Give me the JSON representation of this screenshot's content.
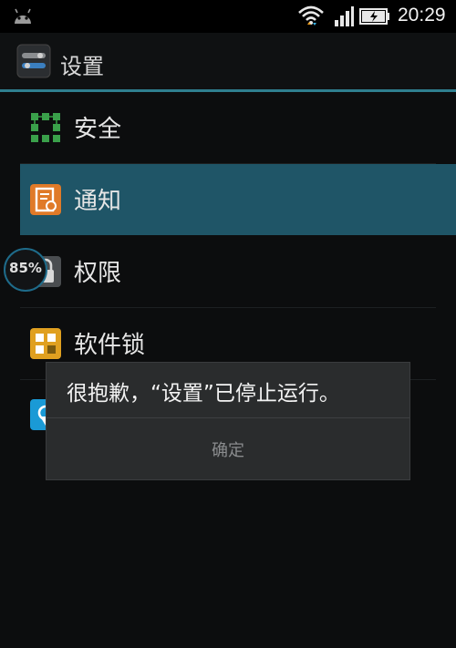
{
  "status_bar": {
    "time": "20:29",
    "icons": [
      "android-icon",
      "wifi-icon",
      "signal-icon",
      "battery-charging-icon"
    ]
  },
  "action_bar": {
    "title": "设置",
    "icon": "settings-app-icon"
  },
  "list": {
    "items": [
      {
        "label": "安全",
        "icon": "security-grid-icon",
        "selected": false
      },
      {
        "label": "通知",
        "icon": "notification-icon",
        "selected": true
      },
      {
        "label": "权限",
        "icon": "permission-lock-icon",
        "selected": false
      },
      {
        "label": "软件锁",
        "icon": "app-lock-icon",
        "selected": false
      }
    ]
  },
  "floating_widget": {
    "text": "85%",
    "icon": "memory-boost-icon"
  },
  "dialog": {
    "message": "很抱歉，“设置”已停止运行。",
    "ok_label": "确定"
  },
  "colors": {
    "accent": "#2f7f8f",
    "selected_bg": "#1f5567",
    "background": "#0c0d0e",
    "dialog_bg": "#2a2c2d"
  }
}
